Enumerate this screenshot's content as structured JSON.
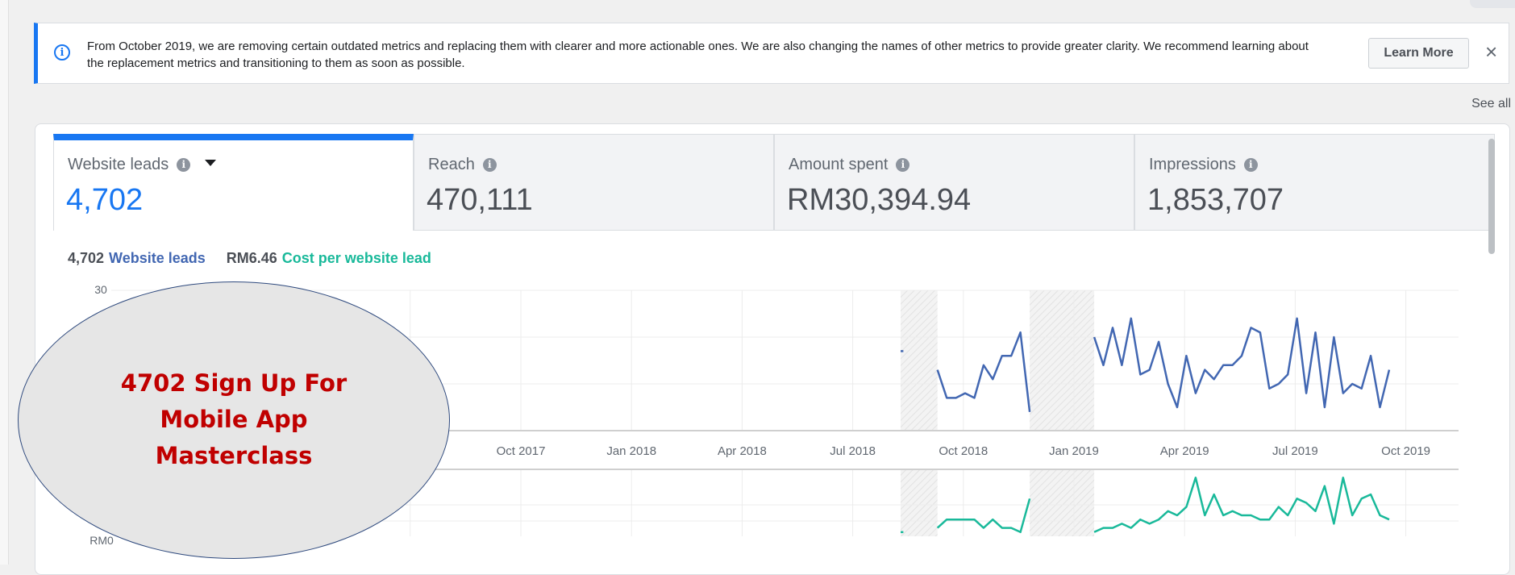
{
  "banner": {
    "message": "From October 2019, we are removing certain outdated metrics and replacing them with clearer and more actionable ones. We are also changing the names of other metrics to provide greater clarity. We recommend learning about the replacement metrics and transitioning to them as soon as possible.",
    "learn_more_label": "Learn More",
    "close_glyph": "×",
    "info_glyph": "i"
  },
  "see_all_label": "See all",
  "tabs": [
    {
      "label": "Website leads",
      "value": "4,702",
      "active": true
    },
    {
      "label": "Reach",
      "value": "470,111",
      "active": false
    },
    {
      "label": "Amount spent",
      "value": "RM30,394.94",
      "active": false
    },
    {
      "label": "Impressions",
      "value": "1,853,707",
      "active": false
    }
  ],
  "tab_info_glyph": "i",
  "summary": {
    "leads_count": "4,702",
    "leads_label": "Website leads",
    "cost_value": "RM6.46",
    "cost_label": "Cost per website lead"
  },
  "overlay_text": [
    "4702 Sign Up For",
    "Mobile App",
    "Masterclass"
  ],
  "colors": {
    "accent": "#1877f2",
    "leads_series": "#4267b2",
    "cost_series": "#19b99a",
    "overlay_text": "#c00000"
  },
  "chart_data": [
    {
      "type": "line",
      "series_name": "Website leads",
      "y_ticks": [
        "30"
      ],
      "ylim": [
        0,
        30
      ],
      "x_tick_labels": [
        "Oct 2017",
        "Jan 2018",
        "Apr 2018",
        "Jul 2018",
        "Oct 2018",
        "Jan 2019",
        "Apr 2019",
        "Jul 2019",
        "Oct 2019"
      ],
      "x_range": [
        0,
        110
      ],
      "shaded_ranges": [
        [
          64,
          68
        ],
        [
          78,
          85
        ]
      ],
      "segments": [
        [
          [
            64,
            17
          ],
          [
            64.3,
            17
          ]
        ],
        [
          [
            68,
            13
          ],
          [
            69,
            7
          ],
          [
            70,
            7
          ],
          [
            71,
            8
          ],
          [
            72,
            7
          ],
          [
            73,
            14
          ],
          [
            74,
            11
          ],
          [
            75,
            16
          ],
          [
            76,
            16
          ],
          [
            77,
            21
          ],
          [
            78,
            4
          ]
        ],
        [
          [
            85,
            20
          ],
          [
            86,
            14
          ],
          [
            87,
            22
          ],
          [
            88,
            14
          ],
          [
            89,
            24
          ],
          [
            90,
            12
          ],
          [
            91,
            13
          ],
          [
            92,
            19
          ],
          [
            93,
            10
          ],
          [
            94,
            5
          ],
          [
            95,
            16
          ],
          [
            96,
            8
          ],
          [
            97,
            13
          ],
          [
            98,
            11
          ],
          [
            99,
            14
          ],
          [
            100,
            14
          ],
          [
            101,
            16
          ],
          [
            102,
            22
          ],
          [
            103,
            21
          ],
          [
            104,
            9
          ],
          [
            105,
            10
          ],
          [
            106,
            12
          ],
          [
            107,
            24
          ],
          [
            108,
            8
          ],
          [
            109,
            21
          ],
          [
            110,
            5
          ],
          [
            111,
            20
          ],
          [
            112,
            8
          ],
          [
            113,
            10
          ],
          [
            114,
            9
          ],
          [
            115,
            16
          ],
          [
            116,
            5
          ],
          [
            117,
            13
          ]
        ]
      ]
    },
    {
      "type": "line",
      "series_name": "Cost per website lead",
      "y_ticks": [
        "RM0"
      ],
      "ylim": [
        0,
        30
      ],
      "segments": [
        [
          [
            64,
            1
          ],
          [
            64.3,
            1
          ]
        ],
        [
          [
            68,
            2
          ],
          [
            69,
            4
          ],
          [
            70,
            4
          ],
          [
            71,
            4
          ],
          [
            72,
            4
          ],
          [
            73,
            2
          ],
          [
            74,
            4
          ],
          [
            75,
            2
          ],
          [
            76,
            2
          ],
          [
            77,
            1
          ],
          [
            78,
            9
          ]
        ],
        [
          [
            85,
            1
          ],
          [
            86,
            2
          ],
          [
            87,
            2
          ],
          [
            88,
            3
          ],
          [
            89,
            2
          ],
          [
            90,
            4
          ],
          [
            91,
            3
          ],
          [
            92,
            4
          ],
          [
            93,
            6
          ],
          [
            94,
            5
          ],
          [
            95,
            7
          ],
          [
            96,
            14
          ],
          [
            97,
            5
          ],
          [
            98,
            10
          ],
          [
            99,
            5
          ],
          [
            100,
            6
          ],
          [
            101,
            5
          ],
          [
            102,
            5
          ],
          [
            103,
            4
          ],
          [
            104,
            4
          ],
          [
            105,
            7
          ],
          [
            106,
            5
          ],
          [
            107,
            9
          ],
          [
            108,
            8
          ],
          [
            109,
            6
          ],
          [
            110,
            12
          ],
          [
            111,
            3
          ],
          [
            112,
            14
          ],
          [
            113,
            5
          ],
          [
            114,
            9
          ],
          [
            115,
            10
          ],
          [
            116,
            5
          ],
          [
            117,
            4
          ]
        ]
      ]
    }
  ]
}
